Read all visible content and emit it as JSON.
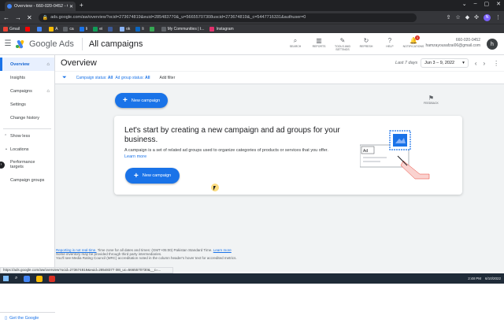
{
  "browser": {
    "tab_title": "Overview - 660-020-0452 - Goo",
    "address": "ads.google.com/aw/overview?ocid=273674819&euid=285483770&_u=56655707308uscid=273674819&_c=5447716331&authuser=0",
    "bookmarks": [
      {
        "label": "Gmail",
        "color": "#ea4335"
      },
      {
        "label": "",
        "color": "#ff0000"
      },
      {
        "label": "",
        "color": "#4285f4"
      },
      {
        "label": "A",
        "color": "#fbbc04"
      },
      {
        "label": "ca",
        "color": "#5f6368"
      },
      {
        "label": "Ii",
        "color": "#1a73e8"
      },
      {
        "label": "ei",
        "color": "#0f9d58"
      },
      {
        "label": "",
        "color": "#3b5998"
      },
      {
        "label": "ok",
        "color": "#8ab4f8"
      },
      {
        "label": "li",
        "color": "#0a66c2"
      },
      {
        "label": "",
        "color": "#34a853"
      },
      {
        "label": "My Communities | t...",
        "color": "#5f6368"
      },
      {
        "label": "Instagram",
        "color": "#e1306c"
      }
    ],
    "status_url": "https://ads.google.com/aw/overview?ocid=273674819&euid=28548377 08t_uc=5665570730&__c=..."
  },
  "header": {
    "brand": "Google Ads",
    "breadcrumb": "All campaigns",
    "tools": [
      {
        "label": "SEARCH",
        "icon": "search-icon",
        "glyph": "⌕"
      },
      {
        "label": "REPORTS",
        "icon": "reports-icon",
        "glyph": "▥"
      },
      {
        "label": "TOOLS AND SETTINGS",
        "icon": "wrench-icon",
        "glyph": "✎"
      },
      {
        "label": "REFRESH",
        "icon": "refresh-icon",
        "glyph": "↻"
      },
      {
        "label": "HELP",
        "icon": "help-icon",
        "glyph": "?"
      },
      {
        "label": "NOTIFICATIONS",
        "icon": "bell-icon",
        "glyph": "🔔"
      }
    ],
    "notification_count": "1",
    "account_id": "660-020-0452",
    "account_email": "hamzayousafzai06@gmail.com",
    "avatar_letter": "h"
  },
  "sidebar": {
    "items": [
      {
        "label": "Overview"
      },
      {
        "label": "Insights"
      },
      {
        "label": "Campaigns"
      },
      {
        "label": "Settings"
      },
      {
        "label": "Change history"
      }
    ],
    "show_less": "Show less",
    "extra": [
      {
        "label": "Locations"
      },
      {
        "label": "Performance targets"
      },
      {
        "label": "Campaign groups"
      }
    ],
    "get_app": "Get the Google"
  },
  "main": {
    "title": "Overview",
    "last_days": "Last 7 days",
    "date_range": "Jun 3 – 9, 2022",
    "filter_status_label": "Campaign status:",
    "filter_status_value": "All",
    "filter_ad_group_label": "Ad group status:",
    "filter_ad_group_value": "All",
    "add_filter": "Add filter",
    "new_campaign": "New campaign",
    "feedback": "FEEDBACK",
    "card": {
      "heading": "Let's start by creating a new campaign and ad groups for your business.",
      "description": "A campaign is a set of related ad groups used to organize categories of products or services that you offer.",
      "learn_more": "Learn more",
      "button": "New campaign",
      "illustration_label": "Ad"
    },
    "footer": {
      "line1_link": "Reporting is not real-time.",
      "line1_text": "Time zone for all dates and times: (GMT+05:00) Pakistan Standard Time.",
      "line1_learn": "Learn more",
      "line2": "Some inventory may be provided through third party intermediaries.",
      "line3": "You'll see Media Rating Council (MRC) accreditation noted in the column header's hover text for accredited metrics."
    }
  },
  "taskbar": {
    "time": "2:48 PM",
    "date": "6/10/2022"
  }
}
